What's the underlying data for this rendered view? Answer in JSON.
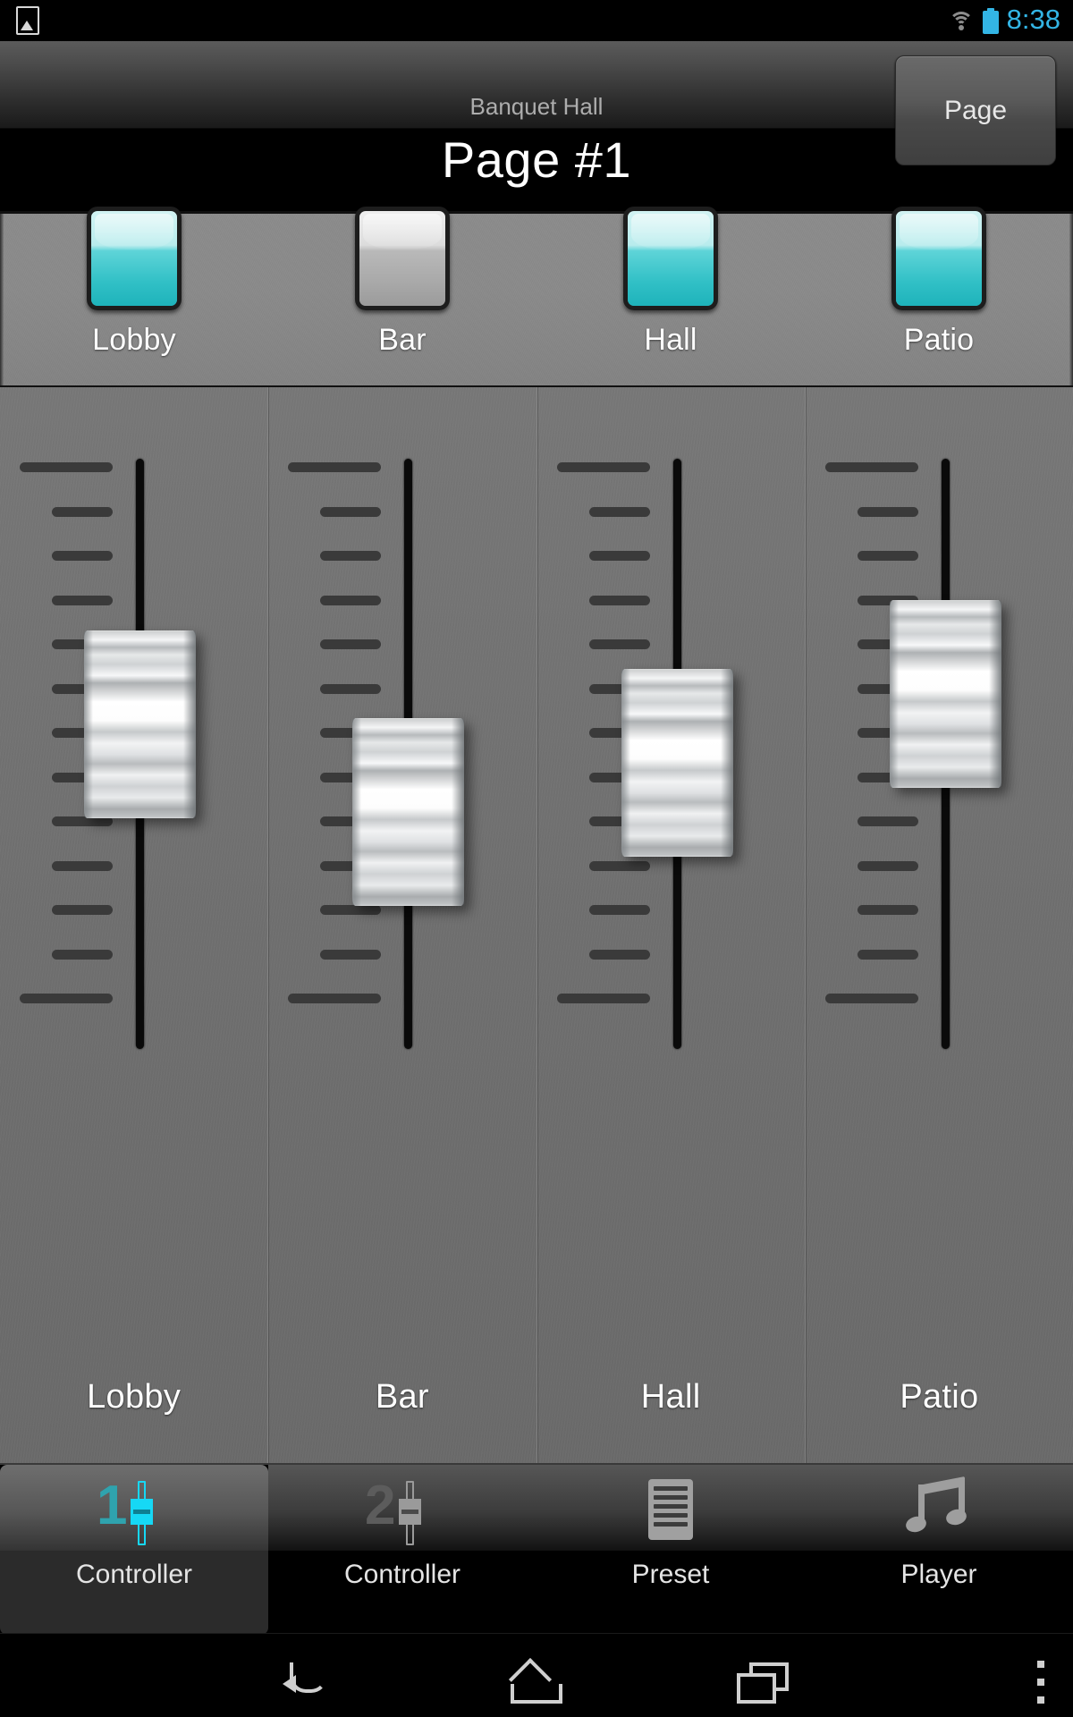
{
  "status_bar": {
    "notification_icon": "image-icon",
    "wifi_icon": "wifi-icon",
    "battery_icon": "battery-icon",
    "clock": "8:38",
    "accent_color": "#33b5e5"
  },
  "title_bar": {
    "subtitle": "Banquet Hall",
    "title": "Page #1",
    "page_button_label": "Page"
  },
  "toggles": {
    "accent_on_color": "#31c0c6",
    "items": [
      {
        "label": "Lobby",
        "state": "on"
      },
      {
        "label": "Bar",
        "state": "off"
      },
      {
        "label": "Hall",
        "state": "on"
      },
      {
        "label": "Patio",
        "state": "on"
      }
    ]
  },
  "faders": {
    "items": [
      {
        "label": "Lobby",
        "value": 58
      },
      {
        "label": "Bar",
        "value": 35
      },
      {
        "label": "Hall",
        "value": 48
      },
      {
        "label": "Patio",
        "value": 66
      }
    ]
  },
  "tabs": {
    "selected_index": 0,
    "items": [
      {
        "label": "Controller",
        "icon": "fader-1-icon"
      },
      {
        "label": "Controller",
        "icon": "fader-2-icon"
      },
      {
        "label": "Preset",
        "icon": "preset-list-icon"
      },
      {
        "label": "Player",
        "icon": "music-note-icon"
      }
    ]
  },
  "nav_bar": {
    "back": "back-icon",
    "home": "home-icon",
    "recents": "recents-icon",
    "menu": "overflow-menu-icon"
  }
}
